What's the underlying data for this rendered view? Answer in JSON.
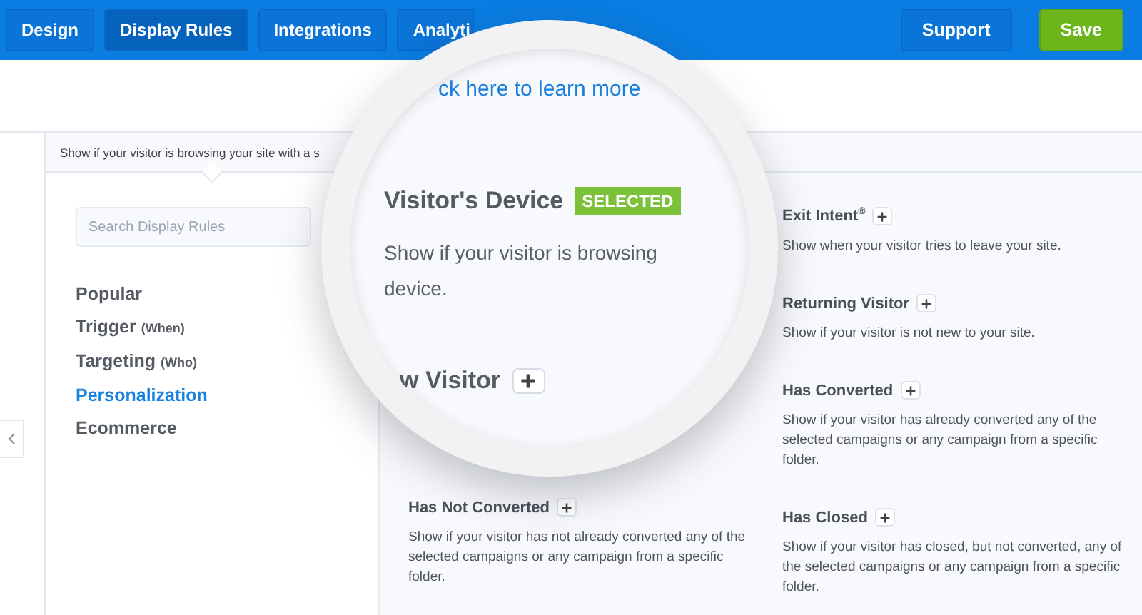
{
  "toolbar": {
    "tabs": [
      {
        "label": "Design",
        "selected": false
      },
      {
        "label": "Display Rules",
        "selected": true
      },
      {
        "label": "Integrations",
        "selected": false
      },
      {
        "label": "Analyti",
        "selected": false
      }
    ],
    "actions": [
      {
        "label": "Support",
        "kind": "secondary"
      },
      {
        "label": "Save",
        "kind": "primary"
      }
    ]
  },
  "hint": "Show if your visitor is browsing your site with a s",
  "sidebar": {
    "search": {
      "placeholder": "Search Display Rules"
    },
    "categories": [
      {
        "label": "Popular",
        "selected": false
      },
      {
        "label": "Trigger",
        "qualifier": "(When)",
        "selected": false
      },
      {
        "label": "Targeting",
        "qualifier": "(Who)",
        "selected": false
      },
      {
        "label": "Personalization",
        "selected": true
      },
      {
        "label": "Ecommerce",
        "selected": false
      }
    ]
  },
  "magnifier": {
    "link": "ck here to learn more",
    "title": "Visitor's Device",
    "badge": "SELECTED",
    "description_lines": [
      "Show if your visitor is browsing",
      "device."
    ],
    "next_title": "w Visitor"
  },
  "rules_left": [
    {
      "title": "Has Not Converted",
      "description": "Show if your visitor has not already converted any of the selected campaigns or any campaign from a specific folder."
    }
  ],
  "rules_right": [
    {
      "title": "Exit Intent$^{®}$",
      "description": "Show when your visitor tries to leave your site."
    },
    {
      "title": "Returning Visitor",
      "description": "Show if your visitor is not new to your site."
    },
    {
      "title": "Has Converted",
      "description": "Show if your visitor has already converted any of the selected campaigns or any campaign from a specific folder."
    },
    {
      "title": "Has Closed",
      "description": "Show if your visitor has closed, but not converted, any of the selected campaigns or any campaign from a specific folder."
    }
  ]
}
